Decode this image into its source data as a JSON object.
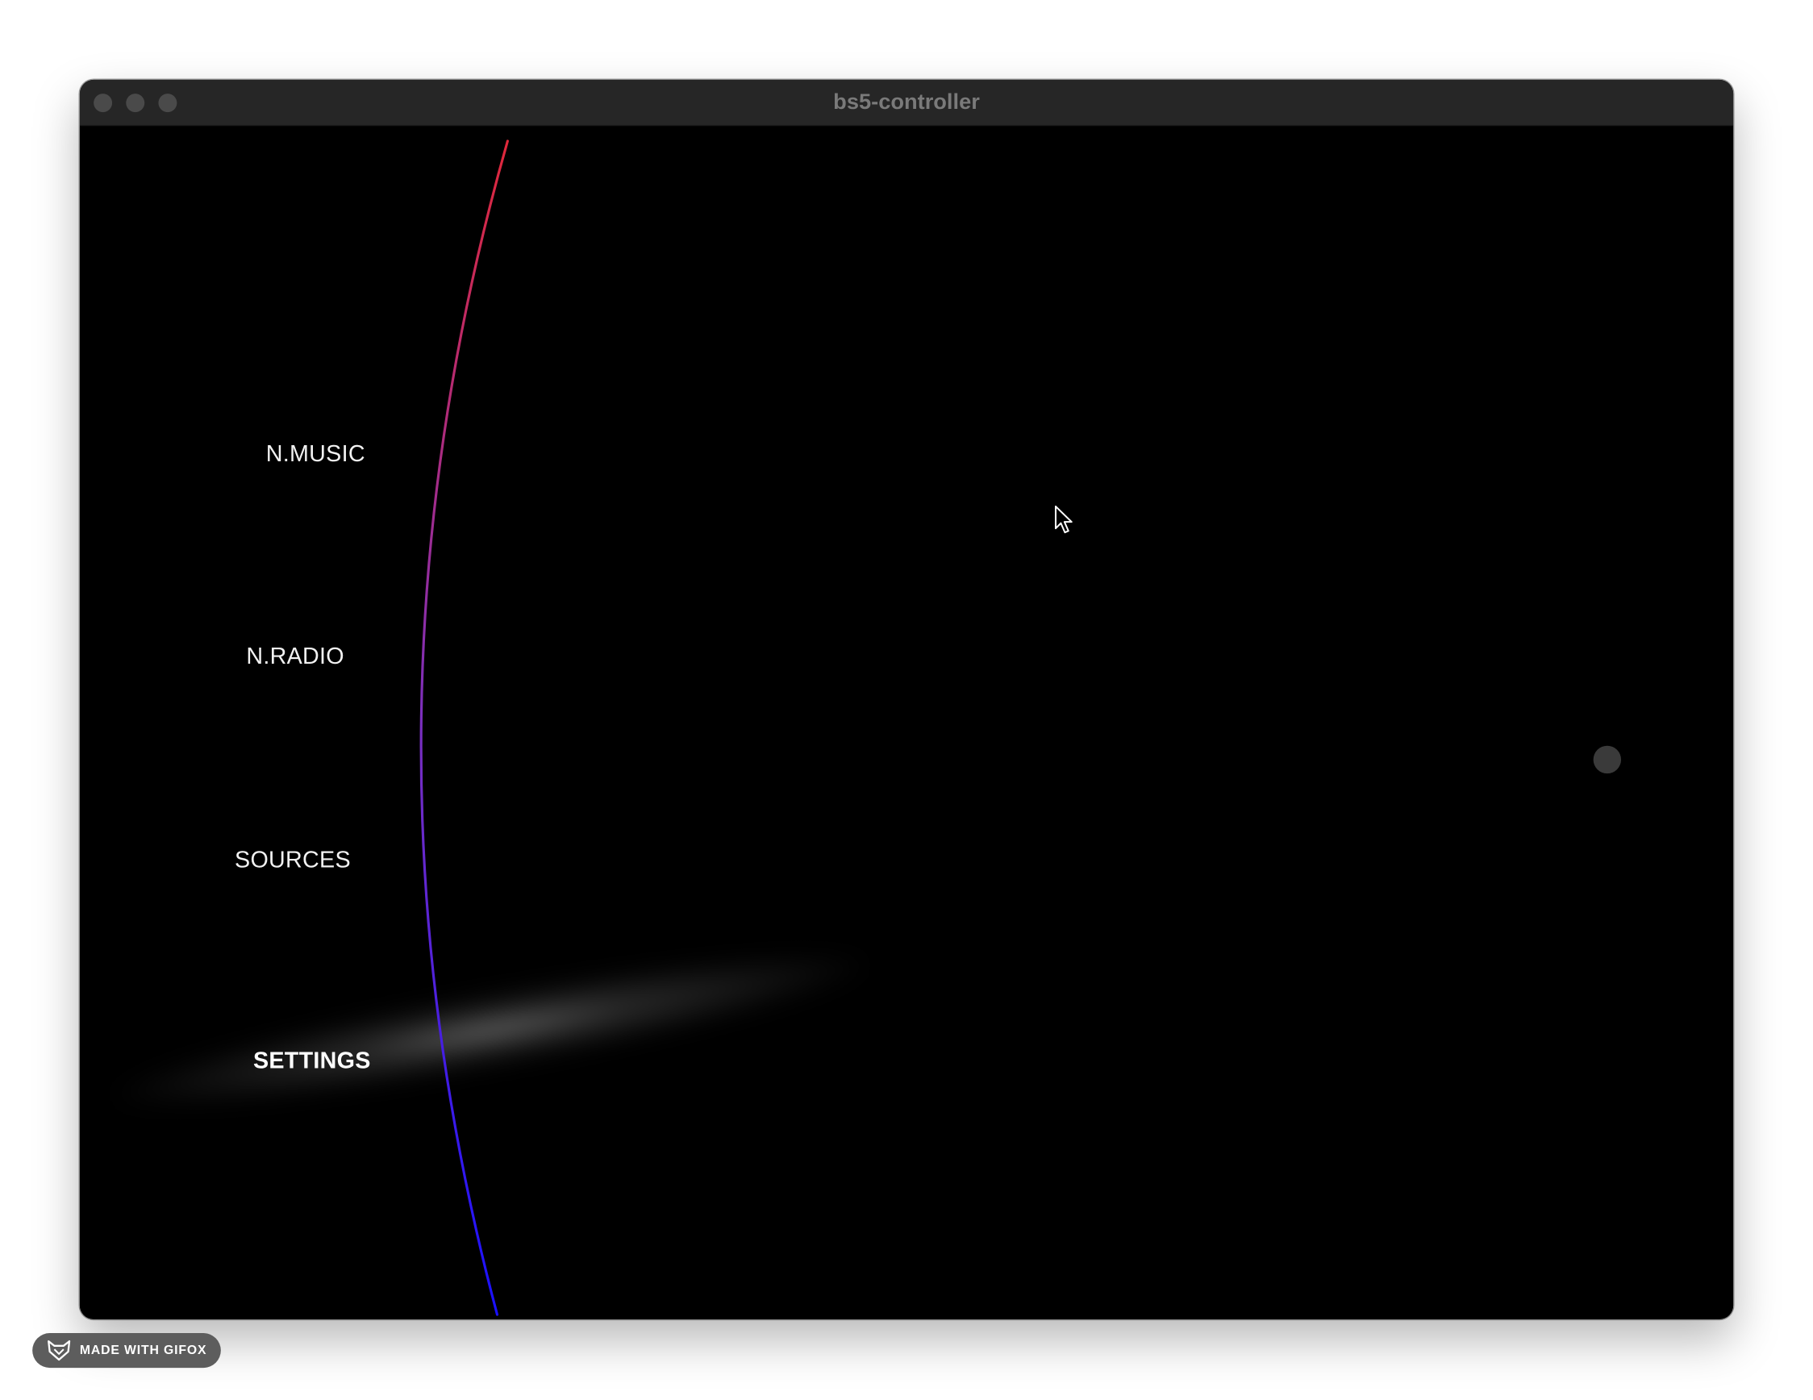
{
  "window": {
    "title": "bs5-controller"
  },
  "menu": {
    "items": [
      {
        "label": "N.MUSIC",
        "active": false
      },
      {
        "label": "N.RADIO",
        "active": false
      },
      {
        "label": "SOURCES",
        "active": false
      },
      {
        "label": "SETTINGS",
        "active": true
      }
    ]
  },
  "arc": {
    "color_top": "#e0283a",
    "color_mid": "#7a2fc0",
    "color_bottom": "#1a10ff"
  },
  "badge": {
    "label": "MADE WITH GIFOX",
    "icon": "fox-icon"
  },
  "icons": {
    "cursor": "mouse-pointer-icon",
    "scroll_indicator": "dot-icon"
  }
}
